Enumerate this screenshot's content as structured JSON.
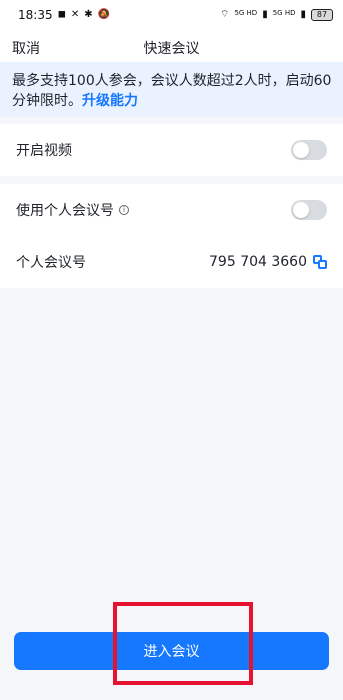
{
  "status_bar": {
    "time": "18:35",
    "left_icons": [
      "nfc-icon",
      "vibrate-icon",
      "bluetooth-icon",
      "silent-icon"
    ],
    "signal_label_1": "5G HD",
    "signal_label_2": "5G HD",
    "battery": "87"
  },
  "nav": {
    "cancel": "取消",
    "title": "快速会议"
  },
  "notice": {
    "text": "最多支持100人参会，会议人数超过2人时，启动60分钟限时。",
    "link": "升级能力"
  },
  "settings": {
    "video": "开启视频",
    "personal_meeting_number": "使用个人会议号",
    "personal_meeting_id_label": "个人会议号",
    "personal_meeting_id_value": "795 704 3660"
  },
  "action": {
    "enter_meeting": "进入会议"
  },
  "colors": {
    "accent": "#1677ff",
    "highlight": "#e5132f"
  }
}
